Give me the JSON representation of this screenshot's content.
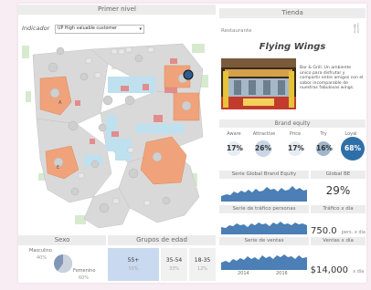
{
  "left_panel": {
    "title": "Primer nivel",
    "indicator_label": "Indicador",
    "indicator_value": "UP High valuable customer",
    "map_labels": {
      "building_a": "A",
      "building_e": "E"
    }
  },
  "demographics": {
    "sex_title": "Sexo",
    "male_label": "Masculino",
    "male_pct": "40%",
    "female_label": "Femenino",
    "female_pct": "60%",
    "female_fraction": 0.6,
    "age_title": "Grupos de edad",
    "age_groups": [
      {
        "label": "55+",
        "pct": "55%"
      },
      {
        "label": "35-54",
        "pct": "33%"
      },
      {
        "label": "18-35",
        "pct": "12%"
      }
    ]
  },
  "store": {
    "title": "Tienda",
    "section_label": "Restaurante",
    "name": "Flying Wings",
    "description": "Bar & Grill. Un ambiente único para disfrutar y compartir entre amigos con el sabor incomparable de nuestras fabulosas wings.",
    "icon": "fork-knife-icon"
  },
  "brand_equity": {
    "title": "Brand equity",
    "stages": [
      {
        "label": "Aware",
        "value": "17%",
        "fraction": 0.17
      },
      {
        "label": "Attractive",
        "value": "26%",
        "fraction": 0.26
      },
      {
        "label": "Price",
        "value": "17%",
        "fraction": 0.17
      },
      {
        "label": "Try",
        "value": "16%",
        "fraction": 0.16
      },
      {
        "label": "Loyal",
        "value": "68%",
        "fraction": 0.68
      }
    ]
  },
  "metrics": {
    "global_be_series_title": "Serie Global Brand Equity",
    "global_be_title": "Global BE",
    "global_be_value": "29%",
    "traffic_series_title": "Serie de tráfico personas",
    "traffic_title": "Tráfico x día",
    "traffic_value": "750.0",
    "traffic_unit": "pers. x día",
    "sales_series_title": "Serie de ventas",
    "sales_title": "Ventas x día",
    "sales_value": "$14,000",
    "sales_unit": "x día",
    "axis_years": [
      "2014",
      "2016"
    ]
  },
  "colors": {
    "header_bg": "#ececec",
    "area_blue": "#4b7fb5",
    "building_orange": "#f0a37a",
    "loyal_blue": "#2f6fa8",
    "age_highlight": "#c9d9ef"
  }
}
